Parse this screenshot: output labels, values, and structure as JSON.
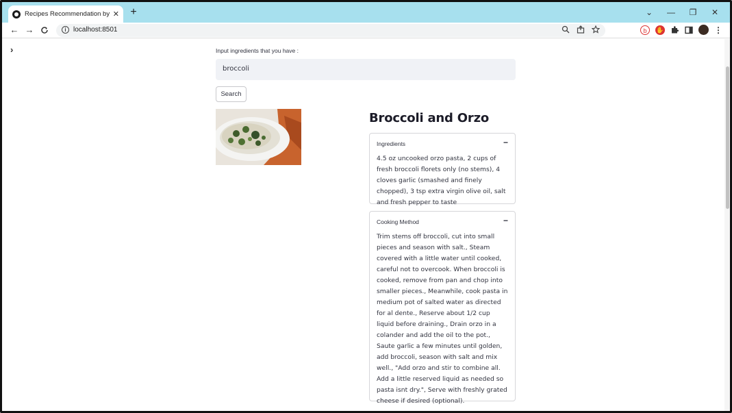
{
  "browser": {
    "tab_title": "Recipes Recommendation by Epi",
    "tab_close": "✕",
    "new_tab": "+",
    "url": "localhost:8501",
    "nav": {
      "back": "←",
      "forward": "→",
      "reload": "C"
    },
    "window_controls": {
      "collapse": "⌄",
      "minimize": "—",
      "restore": "❐",
      "close": "✕"
    }
  },
  "sidebar": {
    "toggle": "›"
  },
  "search": {
    "label": "Input ingredients that you have :",
    "value": "broccoli",
    "button_label": "Search"
  },
  "recipe": {
    "title": "Broccoli and Orzo",
    "ingredients_header": "Ingredients",
    "ingredients_text": "4.5 oz uncooked orzo pasta, 2 cups of fresh broccoli florets only (no stems), 4 cloves garlic (smashed and finely chopped), 3 tsp extra virgin olive oil, salt and fresh pepper to taste",
    "method_header": "Cooking Method",
    "method_text": "Trim stems off broccoli, cut into small pieces and season with salt., Steam covered with a little water until cooked, careful not to overcook. When broccoli is cooked, remove from pan and chop into smaller pieces., Meanwhile, cook pasta in medium pot of salted water as directed for al dente., Reserve about 1/2 cup liquid before draining., Drain orzo in a colander and add the oil to the pot., Saute garlic a few minutes until golden, add broccoli, season with salt and mix well., \"Add orzo and stir to combine all. Add a little reserved liquid as needed so pasta isnt dry.\", Serve with freshly grated cheese if desired (optional).",
    "collapse_symbol": "−"
  }
}
